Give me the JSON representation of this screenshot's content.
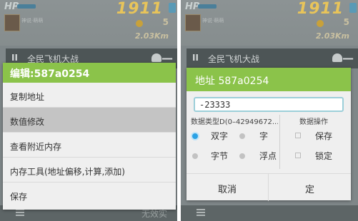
{
  "game": {
    "hp_label": "HP",
    "score": "1911",
    "coins": "5",
    "distance": "2.03Km",
    "player_name": "神说·萌萌"
  },
  "overlay": {
    "pause": "II",
    "title": "全民飞机大战",
    "minimize": "—"
  },
  "left_dialog": {
    "title": "编辑:587a0254",
    "items": [
      {
        "label": "复制地址"
      },
      {
        "label": "数值修改"
      },
      {
        "label": "查看附近内存"
      },
      {
        "label": "内存工具(地址偏移,计算,添加)"
      },
      {
        "label": "保存"
      }
    ],
    "bottom_faint": "无效实"
  },
  "right_dialog": {
    "title": "地址 587a0254",
    "value": "-23333",
    "type_label": "数据类型D(0–42949672...",
    "ops_label": "数据操作",
    "types": [
      {
        "label": "双字",
        "checked": true
      },
      {
        "label": "字",
        "checked": false
      },
      {
        "label": "字节",
        "checked": false
      },
      {
        "label": "浮点",
        "checked": false
      }
    ],
    "ops": [
      {
        "label": "保存"
      },
      {
        "label": "锁定"
      }
    ],
    "cancel_label": "取消",
    "confirm_label": "定"
  },
  "colors": {
    "accent_green": "#8bc34a",
    "radio_checked": "#2aa2e5",
    "input_border": "#9ccfd9"
  }
}
